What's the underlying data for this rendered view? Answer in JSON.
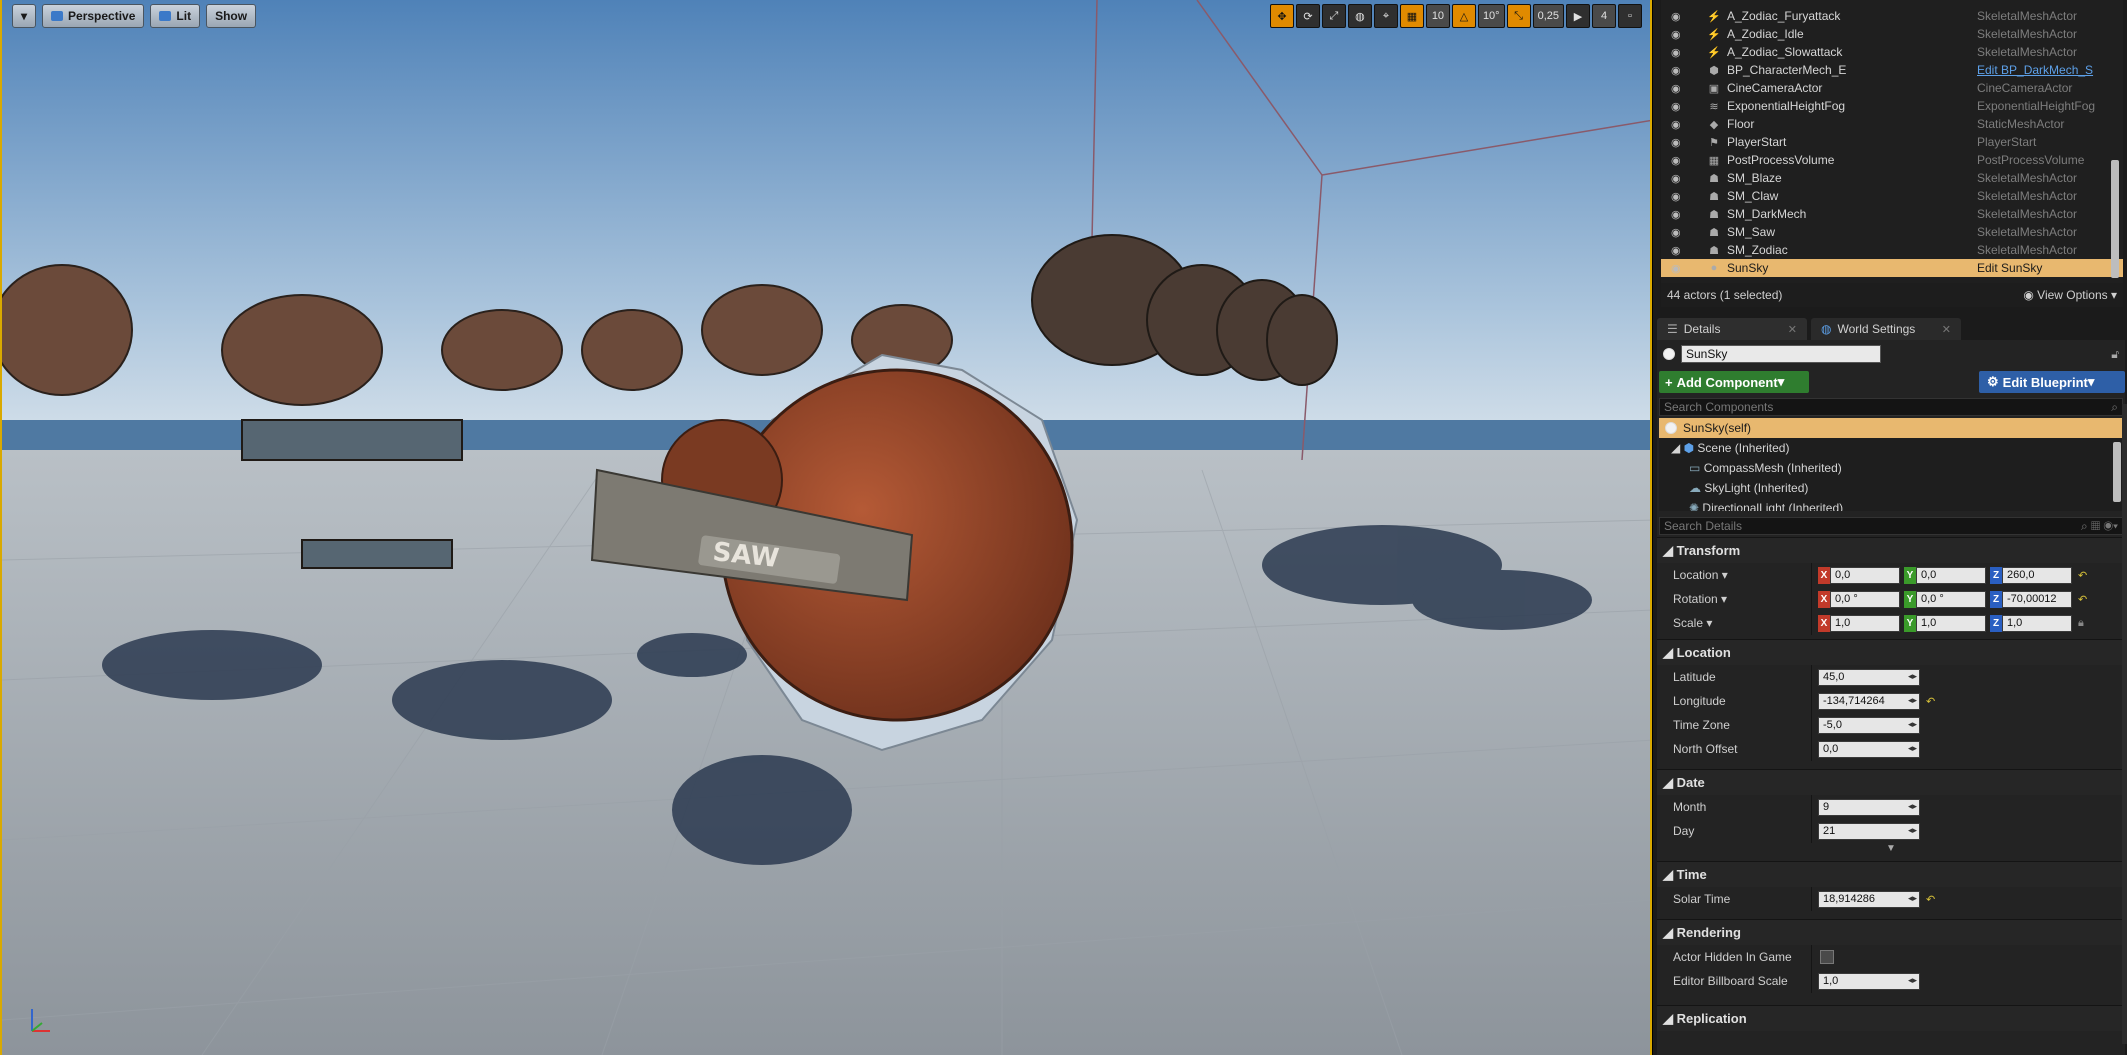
{
  "viewport": {
    "buttons": {
      "menu": "▾",
      "perspective": "Perspective",
      "lit": "Lit",
      "show": "Show"
    },
    "toolbar": {
      "grid_snap": "10",
      "rotation_snap": "10°",
      "scale_snap": "0,25",
      "camera_speed": "4"
    },
    "scene_text": "SAW"
  },
  "outliner": {
    "rows": [
      {
        "name": "A_Zodiac_Furyattack",
        "type": "SkeletalMeshActor",
        "icon": "animation-icon"
      },
      {
        "name": "A_Zodiac_Idle",
        "type": "SkeletalMeshActor",
        "icon": "animation-icon"
      },
      {
        "name": "A_Zodiac_Slowattack",
        "type": "SkeletalMeshActor",
        "icon": "animation-icon"
      },
      {
        "name": "BP_CharacterMech_E",
        "type": "Edit BP_DarkMech_S",
        "icon": "blueprint-icon",
        "link": true
      },
      {
        "name": "CineCameraActor",
        "type": "CineCameraActor",
        "icon": "camera-icon"
      },
      {
        "name": "ExponentialHeightFog",
        "type": "ExponentialHeightFog",
        "icon": "fog-icon"
      },
      {
        "name": "Floor",
        "type": "StaticMeshActor",
        "icon": "mesh-icon"
      },
      {
        "name": "PlayerStart",
        "type": "PlayerStart",
        "icon": "player-icon"
      },
      {
        "name": "PostProcessVolume",
        "type": "PostProcessVolume",
        "icon": "volume-icon"
      },
      {
        "name": "SM_Blaze",
        "type": "SkeletalMeshActor",
        "icon": "skeletal-icon"
      },
      {
        "name": "SM_Claw",
        "type": "SkeletalMeshActor",
        "icon": "skeletal-icon"
      },
      {
        "name": "SM_DarkMech",
        "type": "SkeletalMeshActor",
        "icon": "skeletal-icon"
      },
      {
        "name": "SM_Saw",
        "type": "SkeletalMeshActor",
        "icon": "skeletal-icon"
      },
      {
        "name": "SM_Zodiac",
        "type": "SkeletalMeshActor",
        "icon": "skeletal-icon"
      },
      {
        "name": "SunSky",
        "type": "Edit SunSky",
        "icon": "sphere-icon",
        "selected": true
      }
    ],
    "footer_count": "44 actors (1 selected)",
    "view_options": "View Options"
  },
  "tabs": {
    "details": "Details",
    "world_settings": "World Settings"
  },
  "details": {
    "actor_name": "SunSky",
    "add_component": "Add Component",
    "edit_blueprint": "Edit Blueprint",
    "search_components": "Search Components",
    "components": {
      "self": "SunSky(self)",
      "scene": "Scene (Inherited)",
      "compass": "CompassMesh (Inherited)",
      "skylight": "SkyLight (Inherited)",
      "directional": "DirectionalLight (Inherited)"
    },
    "search_details": "Search Details",
    "transform": {
      "title": "Transform",
      "location_label": "Location",
      "rotation_label": "Rotation",
      "scale_label": "Scale",
      "location": [
        "0,0",
        "0,0",
        "260,0"
      ],
      "rotation": [
        "0,0 °",
        "0,0 °",
        "-70,00012"
      ],
      "scale": [
        "1,0",
        "1,0",
        "1,0"
      ]
    },
    "location_section": {
      "title": "Location",
      "latitude_label": "Latitude",
      "latitude": "45,0",
      "longitude_label": "Longitude",
      "longitude": "-134,714264",
      "timezone_label": "Time Zone",
      "timezone": "-5,0",
      "north_label": "North Offset",
      "north": "0,0"
    },
    "date_section": {
      "title": "Date",
      "month_label": "Month",
      "month": "9",
      "day_label": "Day",
      "day": "21"
    },
    "time_section": {
      "title": "Time",
      "solar_label": "Solar Time",
      "solar": "18,914286"
    },
    "rendering_section": {
      "title": "Rendering",
      "hidden_label": "Actor Hidden In Game",
      "billboard_label": "Editor Billboard Scale",
      "billboard": "1,0"
    },
    "replication_title": "Replication"
  },
  "colors": {
    "selection": "#e8b86f",
    "viewport_border": "#d9a900",
    "add_component": "#2f7d2f",
    "edit_blueprint": "#2e5fa7"
  }
}
